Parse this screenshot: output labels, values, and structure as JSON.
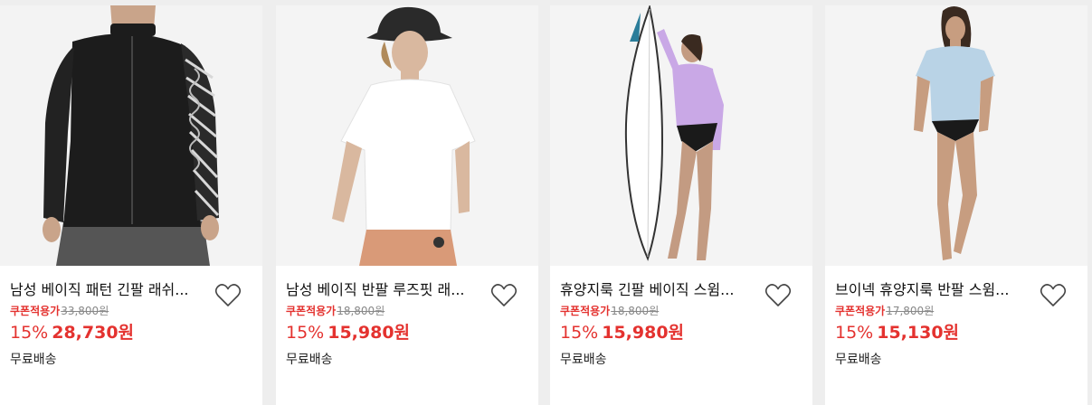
{
  "products": [
    {
      "title": "남성 베이직 패턴 긴팔 래쉬...",
      "coupon_label": "쿠폰적용가",
      "original_price": "33,800원",
      "discount": "15%",
      "price": "28,730원",
      "shipping": "무료배송",
      "wishlist_icon": "heart-outline-icon"
    },
    {
      "title": "남성 베이직 반팔 루즈핏 래...",
      "coupon_label": "쿠폰적용가",
      "original_price": "18,800원",
      "discount": "15%",
      "price": "15,980원",
      "shipping": "무료배송",
      "wishlist_icon": "heart-outline-icon"
    },
    {
      "title": "휴양지룩 긴팔 베이직 스윔...",
      "coupon_label": "쿠폰적용가",
      "original_price": "18,800원",
      "discount": "15%",
      "price": "15,980원",
      "shipping": "무료배송",
      "wishlist_icon": "heart-outline-icon"
    },
    {
      "title": "브이넥 휴양지룩 반팔 스윔...",
      "coupon_label": "쿠폰적용가",
      "original_price": "17,800원",
      "discount": "15%",
      "price": "15,130원",
      "shipping": "무료배송",
      "wishlist_icon": "heart-outline-icon"
    }
  ],
  "colors": {
    "accent_red": "#e4322f",
    "strike_gray": "#888888",
    "page_bg": "#eeeeee",
    "card_bg": "#ffffff"
  }
}
